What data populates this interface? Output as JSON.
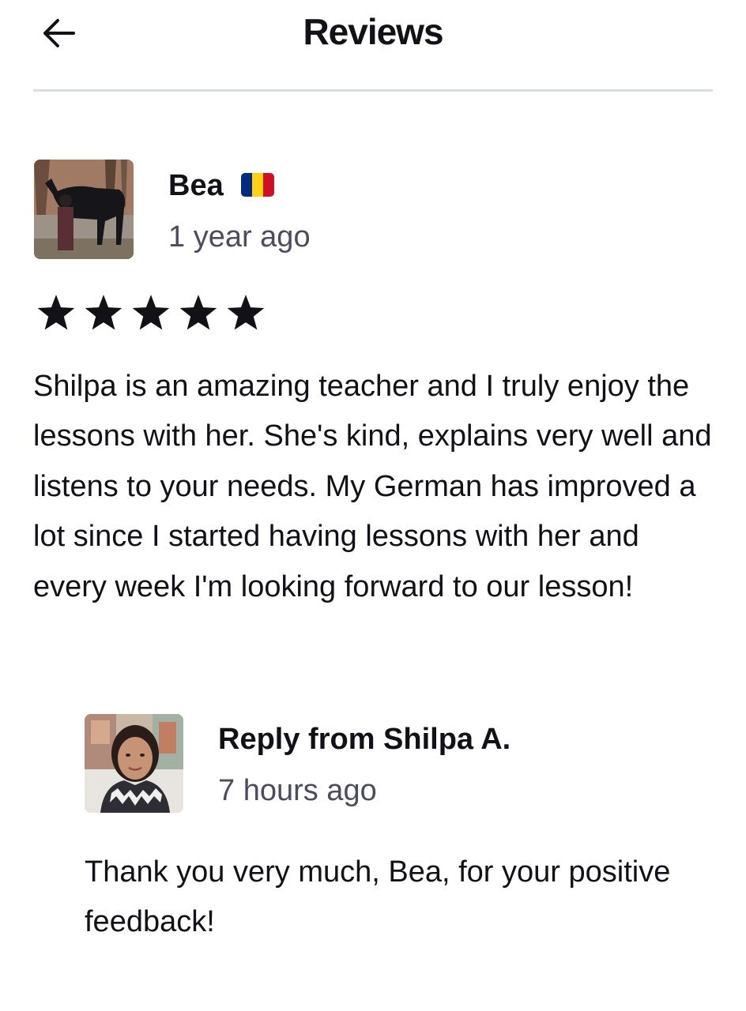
{
  "header": {
    "title": "Reviews",
    "back_icon": "arrow-left-icon"
  },
  "review": {
    "reviewer_name": "Bea",
    "flag_icon": "romania-flag-icon",
    "flag_colors": [
      "#002B7F",
      "#FCD116",
      "#CE1126"
    ],
    "time": "1 year ago",
    "rating": 5,
    "max_rating": 5,
    "text": "Shilpa is an amazing teacher and I truly enjoy the lessons with her. She's kind, explains very well and listens to your needs. My German has improved a lot since I started having lessons with her and every week I'm looking forward to our lesson!"
  },
  "reply": {
    "author": "Reply from Shilpa A.",
    "time": "7 hours ago",
    "text": "Thank you very much, Bea, for your positive feedback!"
  }
}
